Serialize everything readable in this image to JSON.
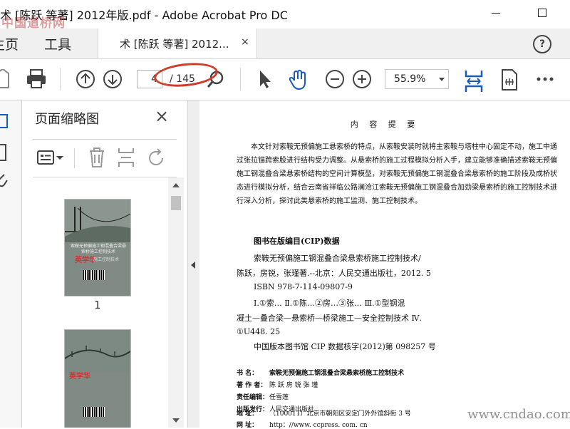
{
  "window": {
    "title": "术 [陈跃 等著] 2012年版.pdf - Adobe Acrobat Pro DC",
    "watermark": "中国道桥网"
  },
  "menubar": {
    "home_label": "主页",
    "tools_label": "工具",
    "tab_label": "术 [陈跃 等著] 2012...",
    "tab_close": "×",
    "help": "?"
  },
  "toolbar": {
    "current_page": "4",
    "total_pages": "/ 145",
    "zoom": "55.9%",
    "highlight_color": "#d23a2a",
    "accent_color": "#1a5cb8"
  },
  "thumbnail_panel": {
    "title": "页面缩略图",
    "close": "×",
    "pages": [
      {
        "number": "1",
        "cover_title": "索鞍无预偏施工钢混叠合梁悬索桥施工控制技术",
        "cover_red_text": "英学华",
        "cover_sub": "施工控制技术"
      },
      {
        "number": "",
        "cover_red_text": "英学华"
      }
    ]
  },
  "document": {
    "heading": "内 容 提 要",
    "abstract": "本文针对索鞍无预偏施工悬索桥的特点，从索鞍安装时就将主索鞍与塔柱中心固定不动，施工中通过张拉锚跨索股进行结构受力调整。从悬索桥的施工过程模拟分析入手，建立能够准确描述索鞍无预偏施工钢混叠合梁悬索桥结构的空间计算模型，对索鞍无预偏施工钢混叠合梁悬索桥的施工阶段及成桥状态进行模拟分析，结合云南省祥临公路澜沧江索鞍无预偏施工钢混叠合加劲梁悬索桥的施工控制技术进行深入分析，探讨此类悬索桥的施工监测、施工控制技术。",
    "cip_title": "图书在版编目(CIP)数据",
    "cip_lines": [
      "索鞍无预偏施工钢混叠合梁悬索桥施工控制技术/",
      "陈跃，房锐，张瑾著.--北京：人民交通出版社，2012. 5",
      "ISBN 978-7-114-09807-9",
      "Ⅰ.①索… Ⅱ.①陈…②房…③张… Ⅲ.①型钢混",
      "凝土—叠合梁—悬索桥—桥梁施工—安全控制技术 Ⅳ.",
      "①U448. 25",
      "中国版本图书馆 CIP 数据核字(2012)第 098257 号"
    ],
    "info": [
      {
        "label": "书 名：",
        "value": "索鞍无预偏施工钢混叠合梁悬索桥施工控制技术"
      },
      {
        "label": "著 作 者：",
        "value": "陈 跃 房 锐 张 瑾"
      },
      {
        "label": "责任编辑：",
        "value": "任雪莲"
      },
      {
        "label": "出版发行：",
        "value": "人民交通出版社"
      },
      {
        "label": "地 址：",
        "value": "（100011）北京市朝阳区安定门外外馆斜街 3 号"
      },
      {
        "label": "网 址：",
        "value": "http：//www. ccpress. com. cn"
      }
    ],
    "watermark": "www.cndao.com"
  }
}
